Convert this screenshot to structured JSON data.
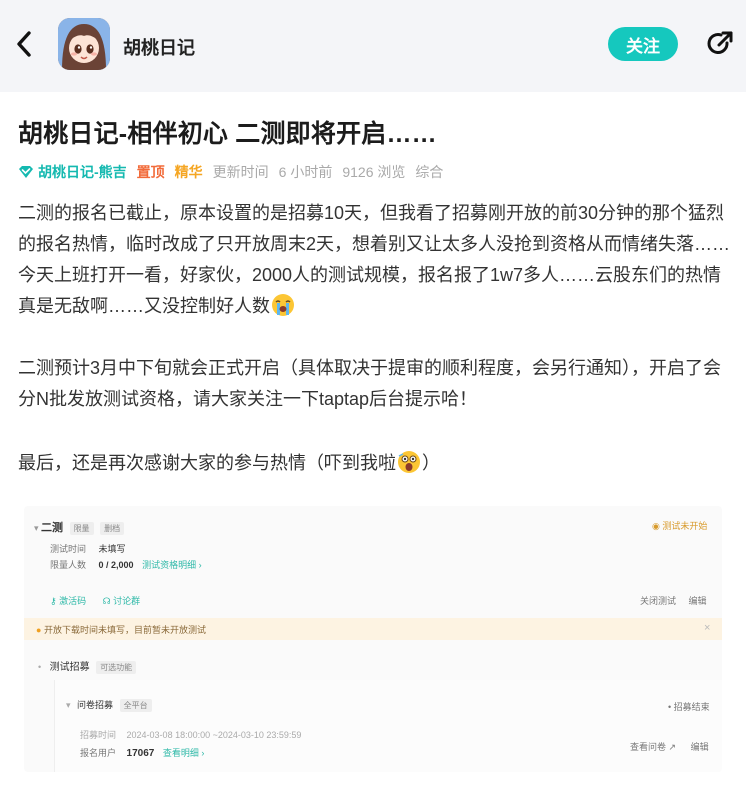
{
  "header": {
    "author": "胡桃日记",
    "follow_label": "关注",
    "back_icon": "chevron-left-icon",
    "share_icon": "share-icon"
  },
  "post": {
    "title": "胡桃日记-相伴初心 二测即将开启……",
    "meta": {
      "author_name": "胡桃日记-熊吉",
      "pinned": "置顶",
      "essence": "精华",
      "updated_label": "更新时间",
      "time_ago": "6 小时前",
      "views": "9126 浏览",
      "category": "综合"
    },
    "paragraph1": "二测的报名已截止，原本设置的是招募10天，但我看了招募刚开放的前30分钟的那个猛烈的报名热情，临时改成了只开放周末2天，想着别又让太多人没抢到资格从而情绪失落……今天上班打开一看，好家伙，2000人的测试规模，报名报了1w7多人……云股东们的热情真是无敌啊……又没控制好人数",
    "paragraph2": "二测预计3月中下旬就会正式开启（具体取决于提审的顺利程度，会另行通知），开启了会分N批发放测试资格，请大家关注一下taptap后台提示哈！",
    "paragraph3_a": "最后，还是再次感谢大家的参与热情（吓到我啦",
    "paragraph3_b": "）"
  },
  "screenshot": {
    "test_title": "二测",
    "tag1": "限量",
    "tag2": "删档",
    "status": "测试未开始",
    "time_label": "测试时间",
    "time_value": "未填写",
    "limit_label": "限量人数",
    "limit_value": "0 / 2,000",
    "limit_link": "测试资格明细 ›",
    "code_label": "激活码",
    "forum_label": "讨论群",
    "close_test": "关闭测试",
    "edit": "编辑",
    "warning": "开放下载时间未填写，目前暂未开放测试",
    "recruit_title": "测试招募",
    "recruit_tag": "可选功能",
    "survey_title": "问卷招募",
    "survey_tag": "全平台",
    "survey_status": "招募结束",
    "recruit_time_label": "招募时间",
    "recruit_time_value": "2024-03-08 18:00:00 ~2024-03-10 23:59:59",
    "signup_label": "报名用户",
    "signup_value": "17067",
    "signup_link": "查看明细 ›",
    "view_survey": "查看问卷",
    "edit2": "编辑"
  },
  "colors": {
    "accent": "#15c8be",
    "pin": "#f26b3a",
    "essence": "#f5a623"
  }
}
